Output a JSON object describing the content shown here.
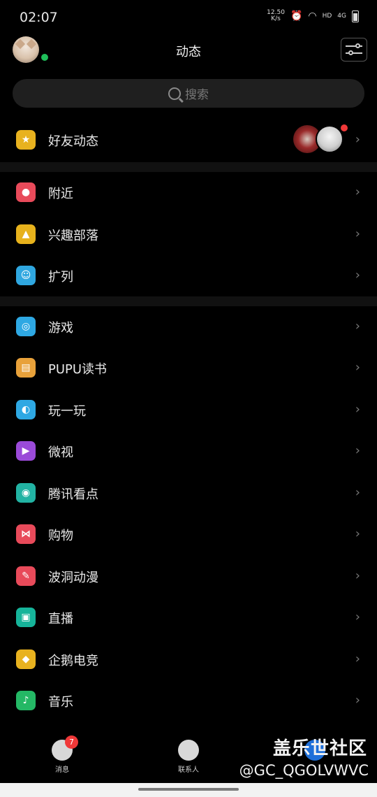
{
  "status": {
    "time": "02:07",
    "net_speed": "12.50",
    "net_unit": "K/s",
    "hd": "HD",
    "network": "4G"
  },
  "header": {
    "title": "动态"
  },
  "search": {
    "placeholder": "搜索"
  },
  "sections": [
    {
      "items": [
        {
          "label": "好友动态",
          "icon": "star-icon",
          "color": "#e8b21f"
        }
      ]
    },
    {
      "items": [
        {
          "label": "附近",
          "icon": "location-pin-icon",
          "color": "#e84a5a"
        },
        {
          "label": "兴趣部落",
          "icon": "tent-icon",
          "color": "#e7b21c"
        },
        {
          "label": "扩列",
          "icon": "smiley-plus-icon",
          "color": "#2fa7e0"
        }
      ]
    },
    {
      "items": [
        {
          "label": "游戏",
          "icon": "gamepad-icon",
          "color": "#2ea8e3"
        },
        {
          "label": "PUPU读书",
          "icon": "book-icon",
          "color": "#e8a13a"
        },
        {
          "label": "玩一玩",
          "icon": "planet-icon",
          "color": "#2ea8e3"
        },
        {
          "label": "微视",
          "icon": "play-icon",
          "color": "#9a4ad8"
        },
        {
          "label": "腾讯看点",
          "icon": "eye-icon",
          "color": "#22b3a3"
        },
        {
          "label": "购物",
          "icon": "bow-icon",
          "color": "#e84a5a"
        },
        {
          "label": "波洞动漫",
          "icon": "comic-icon",
          "color": "#e84a5a"
        },
        {
          "label": "直播",
          "icon": "live-icon",
          "color": "#16b49a"
        },
        {
          "label": "企鹅电竞",
          "icon": "shield-icon",
          "color": "#e8b21f"
        },
        {
          "label": "音乐",
          "icon": "music-icon",
          "color": "#24b865"
        }
      ]
    }
  ],
  "tabs": {
    "messages": {
      "label": "消息",
      "badge": "7",
      "icon": "chat-face-icon"
    },
    "contacts": {
      "label": "联系人",
      "icon": "person-icon"
    }
  },
  "watermark": {
    "line1": "盖乐世社区",
    "line2": "@GC_QGOLVWVC"
  }
}
